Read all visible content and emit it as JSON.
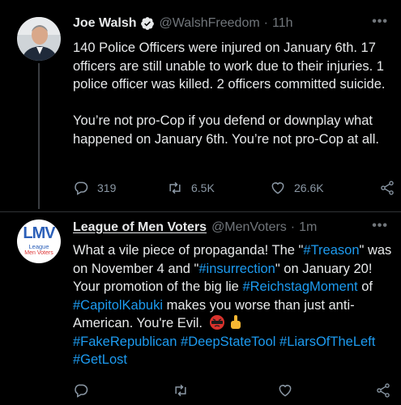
{
  "tweet1": {
    "name": "Joe Walsh",
    "handle": "@WalshFreedom",
    "time": "11h",
    "para1": "140 Police Officers were injured on January 6th. 17 officers are still unable to work due to their injuries. 1 police officer was killed. 2 officers committed suicide.",
    "para2": "You’re not pro-Cop if you defend or downplay what happened on January 6th. You’re not pro-Cop at all.",
    "replies": "319",
    "retweets": "6.5K",
    "likes": "26.6K"
  },
  "tweet2": {
    "name": "League of Men Voters",
    "handle": "@MenVoters",
    "time": "1m",
    "avatar_big": "LMV",
    "avatar_line1": "League",
    "avatar_line2": "Men Voters",
    "text": {
      "s1": "What a vile piece of propaganda! The \"",
      "t1": "#Treason",
      "s2": "\" was on November 4 and \"",
      "t2": "#insurrection",
      "s3": "\" on January 20!  Your promotion of the big lie ",
      "t3": "#ReichstagMoment",
      "s4": " of ",
      "t4": "#CapitolKabuki",
      "s5": " makes you worse than just anti-American. You're Evil. ",
      "t5": "#FakeRepublican",
      "t6": "#DeepStateTool",
      "t7": "#LiarsOfTheLeft",
      "t8": "#GetLost"
    }
  },
  "colors": {
    "link": "#1d9bf0",
    "muted": "#71767b",
    "background": "#000000"
  },
  "icons": [
    "verified-badge-icon",
    "more-icon",
    "reply-icon",
    "retweet-icon",
    "like-icon",
    "share-icon",
    "angry-face-emoji",
    "pointing-up-emoji"
  ]
}
